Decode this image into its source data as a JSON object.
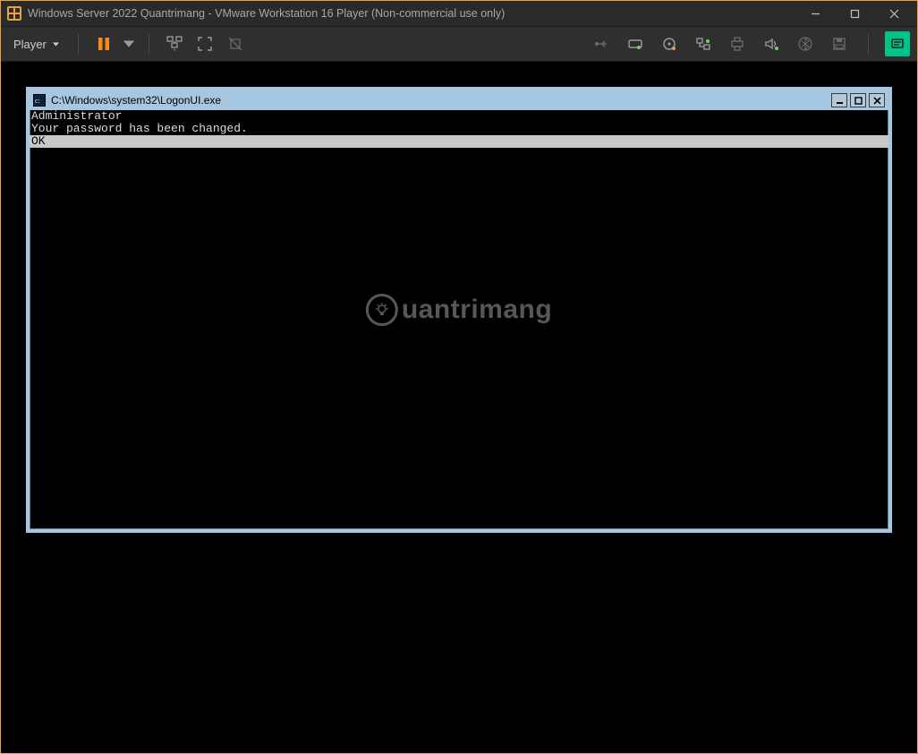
{
  "app": {
    "title": "Windows Server 2022 Quantrimang - VMware Workstation 16 Player (Non-commercial use only)"
  },
  "toolbar": {
    "player_label": "Player",
    "icons": {
      "pause": "pause-icon",
      "dropdown": "chevron-down-icon",
      "send_cad": "send-cad-icon",
      "fullscreen": "fullscreen-icon",
      "unity": "unity-icon",
      "usb": "usb-icon",
      "hdd": "drive-icon",
      "cd": "cd-icon",
      "net": "network-icon",
      "printer": "printer-icon",
      "sound": "sound-icon",
      "bt": "bluetooth-icon",
      "floppy": "floppy-icon",
      "msg": "message-icon"
    }
  },
  "guest": {
    "title": "C:\\Windows\\system32\\LogonUI.exe",
    "lines": [
      {
        "text": "Administrator",
        "selected": false
      },
      {
        "text": "Your password has been changed.",
        "selected": false
      },
      {
        "text": "OK",
        "selected": true
      }
    ]
  },
  "watermark": {
    "text": "uantrimang"
  }
}
